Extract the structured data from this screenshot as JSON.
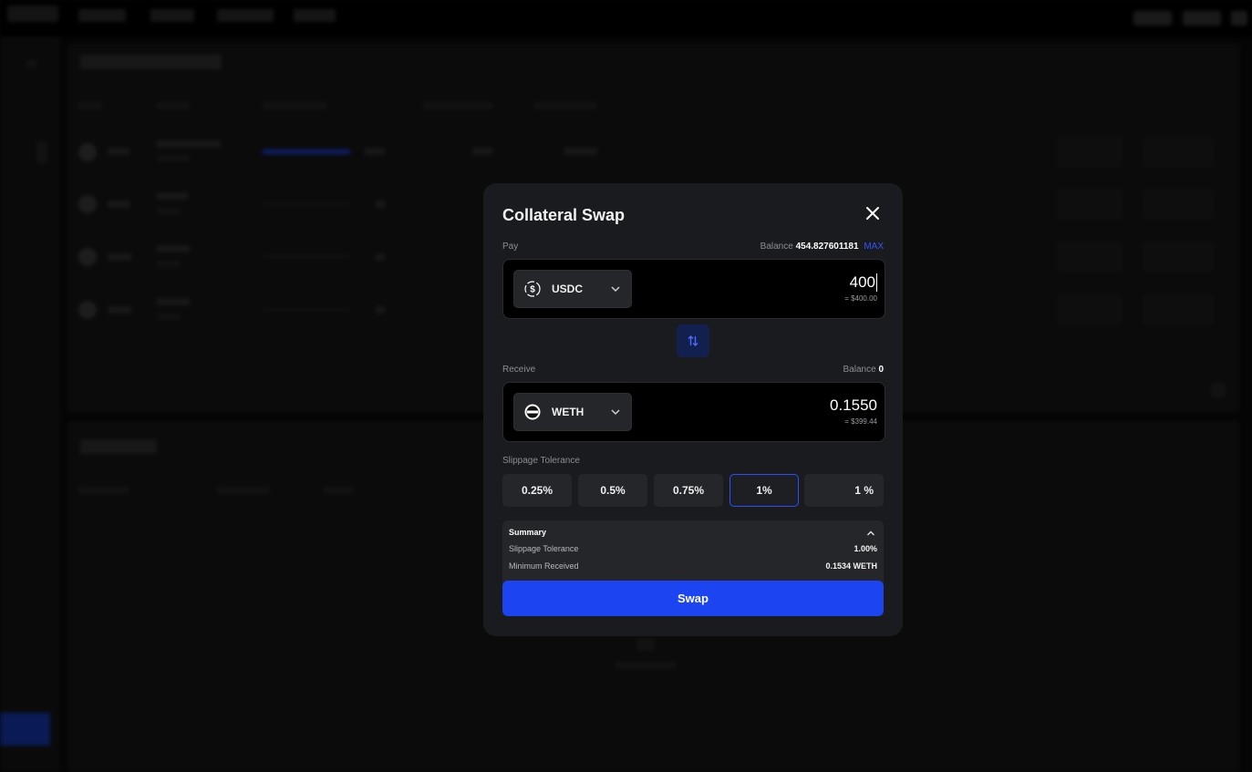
{
  "modal": {
    "title": "Collateral Swap",
    "pay": {
      "label": "Pay",
      "balance_label": "Balance",
      "balance_value": "454.827601181",
      "max_label": "MAX",
      "token": "USDC",
      "token_icon": "usdc-icon",
      "amount": "400",
      "usd_value": "= $400.00"
    },
    "receive": {
      "label": "Receive",
      "balance_label": "Balance",
      "balance_value": "0",
      "token": "WETH",
      "token_icon": "weth-icon",
      "amount": "0.1550",
      "usd_value": "= $399.44"
    },
    "slippage": {
      "label": "Slippage Tolerance",
      "options": [
        "0.25%",
        "0.5%",
        "0.75%",
        "1%"
      ],
      "selected": "1%",
      "custom_value": "1",
      "custom_unit": "%"
    },
    "summary": {
      "title": "Summary",
      "rows": [
        {
          "key": "Slippage Tolerance",
          "value": "1.00%"
        },
        {
          "key": "Minimum Received",
          "value": "0.1534 WETH"
        }
      ]
    },
    "swap_label": "Swap"
  },
  "colors": {
    "accent": "#1c44f0",
    "modal_bg": "#1a1b1e",
    "input_bg": "#000000",
    "page_bg": "#050505"
  }
}
